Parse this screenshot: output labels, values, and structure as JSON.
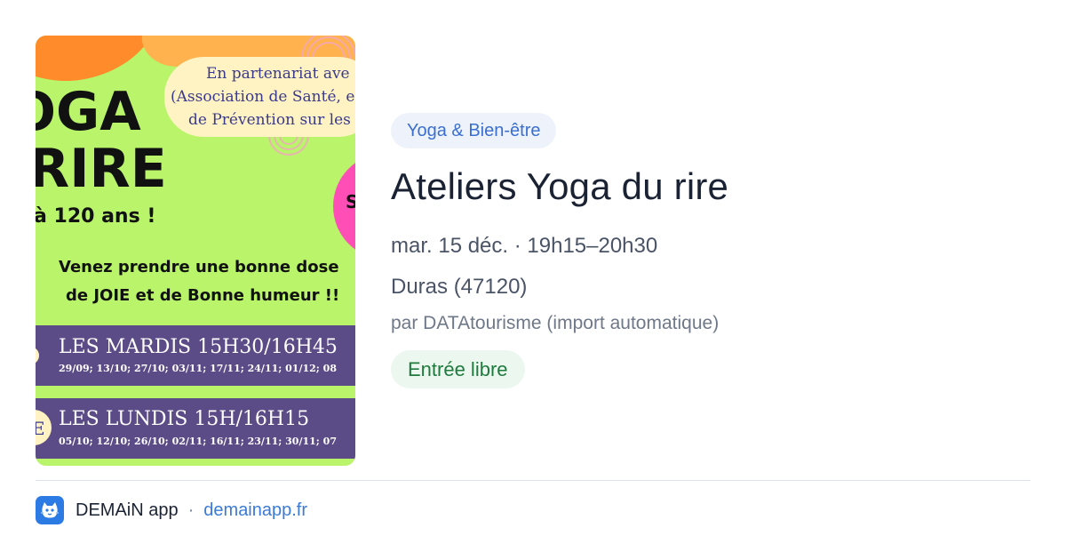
{
  "poster": {
    "partnership": [
      "En partenariat ave",
      "(Association de Santé, e",
      "de Prévention sur les"
    ],
    "headline_1": "OGA",
    "headline_2": "RIRE",
    "age_line": "à 120 ans !",
    "tagline_1": "Venez prendre une bonne dose",
    "tagline_2": "de JOIE et de Bonne humeur !!",
    "session_1_title": "LES MARDIS 15H30/16H45",
    "session_1_dates": "29/09; 13/10; 27/10; 03/11; 17/11; 24/11; 01/12; 08",
    "session_2_title": "LES LUNDIS 15H/16H15",
    "session_2_dates": "05/10; 12/10; 26/10; 02/11; 16/11; 23/11; 30/11; 07",
    "side_letter": "S",
    "side_letter_2": "E"
  },
  "event": {
    "category": "Yoga & Bien-être",
    "title": "Ateliers Yoga du rire",
    "datetime": "mar. 15 déc. · 19h15–20h30",
    "place": "Duras (47120)",
    "source": "par DATAtourisme (import automatique)",
    "price": "Entrée libre"
  },
  "footer": {
    "app_name": "DEMAiN app",
    "separator": "·",
    "domain": "demainapp.fr"
  },
  "colors": {
    "poster_green": "#b9f46a",
    "poster_orange": "#ff9a2e",
    "poster_purple": "#5b4b86",
    "poster_pink": "#ff4fb6",
    "category_text": "#3b6fcf",
    "price_text": "#1f7a3e",
    "link": "#3b7bd6"
  },
  "icons": {
    "app_icon": "demain-app-icon"
  }
}
